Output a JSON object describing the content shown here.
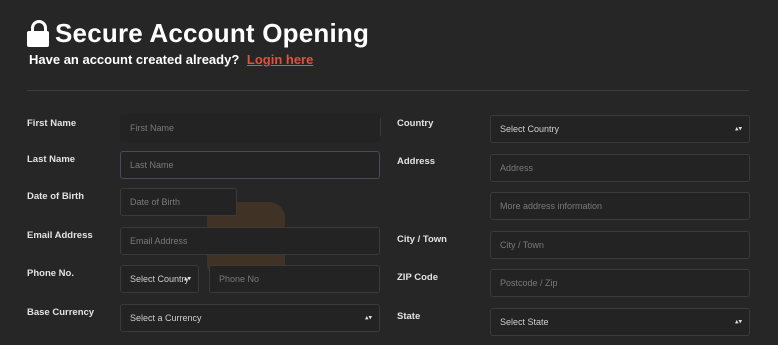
{
  "header": {
    "title": "Secure Account Opening",
    "subtitle": "Have an account created already?",
    "login_link": "Login here"
  },
  "icons": {
    "lock": "lock-icon",
    "select_arrows": "updown-arrows-icon"
  },
  "colors": {
    "background": "#262626",
    "accent_link": "#e2503e",
    "text": "#ffffff"
  },
  "form": {
    "first_name": {
      "label": "First Name",
      "placeholder": "First Name"
    },
    "last_name": {
      "label": "Last Name",
      "placeholder": "Last Name"
    },
    "dob": {
      "label": "Date of Birth",
      "placeholder": "Date of Birth"
    },
    "email": {
      "label": "Email Address",
      "placeholder": "Email Address"
    },
    "phone": {
      "label": "Phone No.",
      "country_select": "Select Country",
      "arrows": "▴▾",
      "placeholder": "Phone No"
    },
    "currency": {
      "label": "Base Currency",
      "select": "Select a Currency",
      "arrows": "▴▾"
    },
    "country": {
      "label": "Country",
      "select": "Select Country",
      "arrows": "▴▾"
    },
    "address": {
      "label": "Address",
      "placeholder": "Address",
      "placeholder2": "More address information"
    },
    "city": {
      "label": "City / Town",
      "placeholder": "City / Town"
    },
    "zip": {
      "label": "ZIP Code",
      "placeholder": "Postcode / Zip"
    },
    "state": {
      "label": "State",
      "select": "Select State",
      "arrows": "▴▾"
    }
  }
}
